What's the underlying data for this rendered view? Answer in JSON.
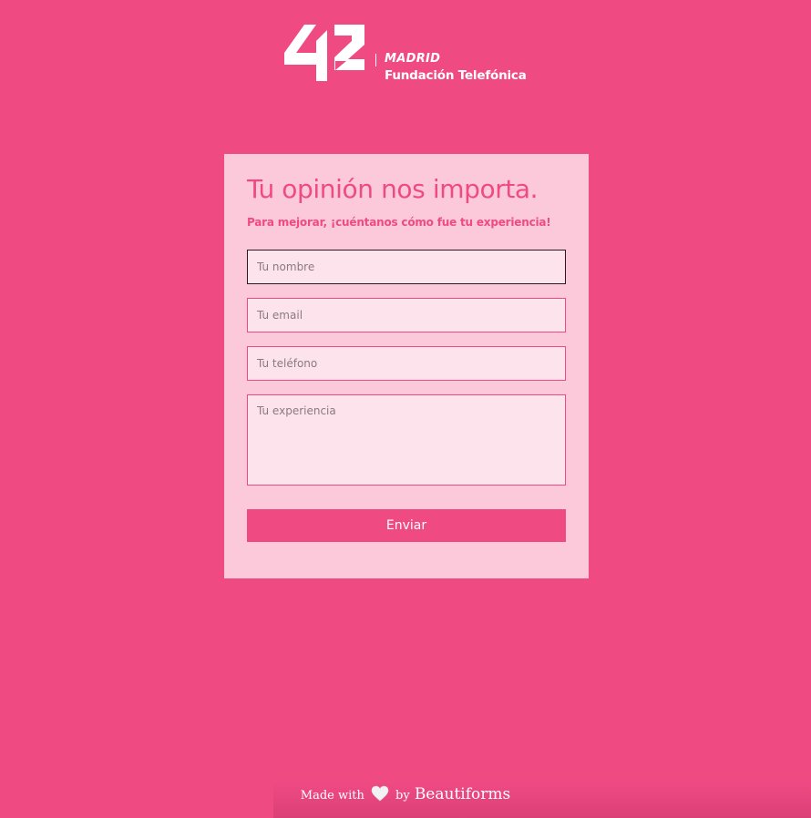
{
  "logo": {
    "mark_text": "42",
    "city": "MADRID",
    "organization": "Fundación Telefónica"
  },
  "form": {
    "title": "Tu opinión nos importa.",
    "subtitle": "Para mejorar, ¡cuéntanos cómo fue tu experiencia!",
    "fields": {
      "name": {
        "value": "",
        "placeholder": "Tu nombre",
        "focused": true
      },
      "email": {
        "value": "",
        "placeholder": "Tu email"
      },
      "phone": {
        "value": "",
        "placeholder": "Tu teléfono"
      },
      "experience": {
        "value": "",
        "placeholder": "Tu experiencia"
      }
    },
    "submit_label": "Enviar"
  },
  "footer": {
    "made_with": "Made with",
    "by": "by",
    "brand": "Beautiforms",
    "icon": "heart-icon"
  },
  "colors": {
    "background": "#f04a83",
    "card": "#fbc9da",
    "field": "#fde4ec",
    "accent": "#f04a83"
  }
}
